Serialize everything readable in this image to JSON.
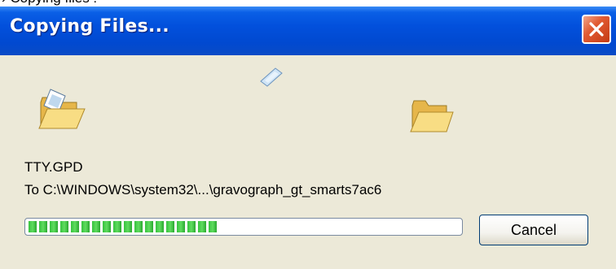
{
  "caption": "› Copying files :",
  "window": {
    "title": "Copying Files...",
    "close_icon": "close-icon"
  },
  "animation": {
    "source_icon": "open-folder-with-document-icon",
    "flying_icon": "flying-document-icon",
    "destination_icon": "open-folder-icon"
  },
  "status": {
    "filename": "TTY.GPD",
    "destination": "To C:\\WINDOWS\\system32\\...\\gravograph_gt_smarts7ac6"
  },
  "progress": {
    "fraction": 0.44
  },
  "buttons": {
    "cancel_label": "Cancel"
  },
  "colors": {
    "titlebar": "#0250dc",
    "close_button": "#e15b33",
    "progress_fill": "#36c23e",
    "dialog_background": "#ece9d8"
  }
}
